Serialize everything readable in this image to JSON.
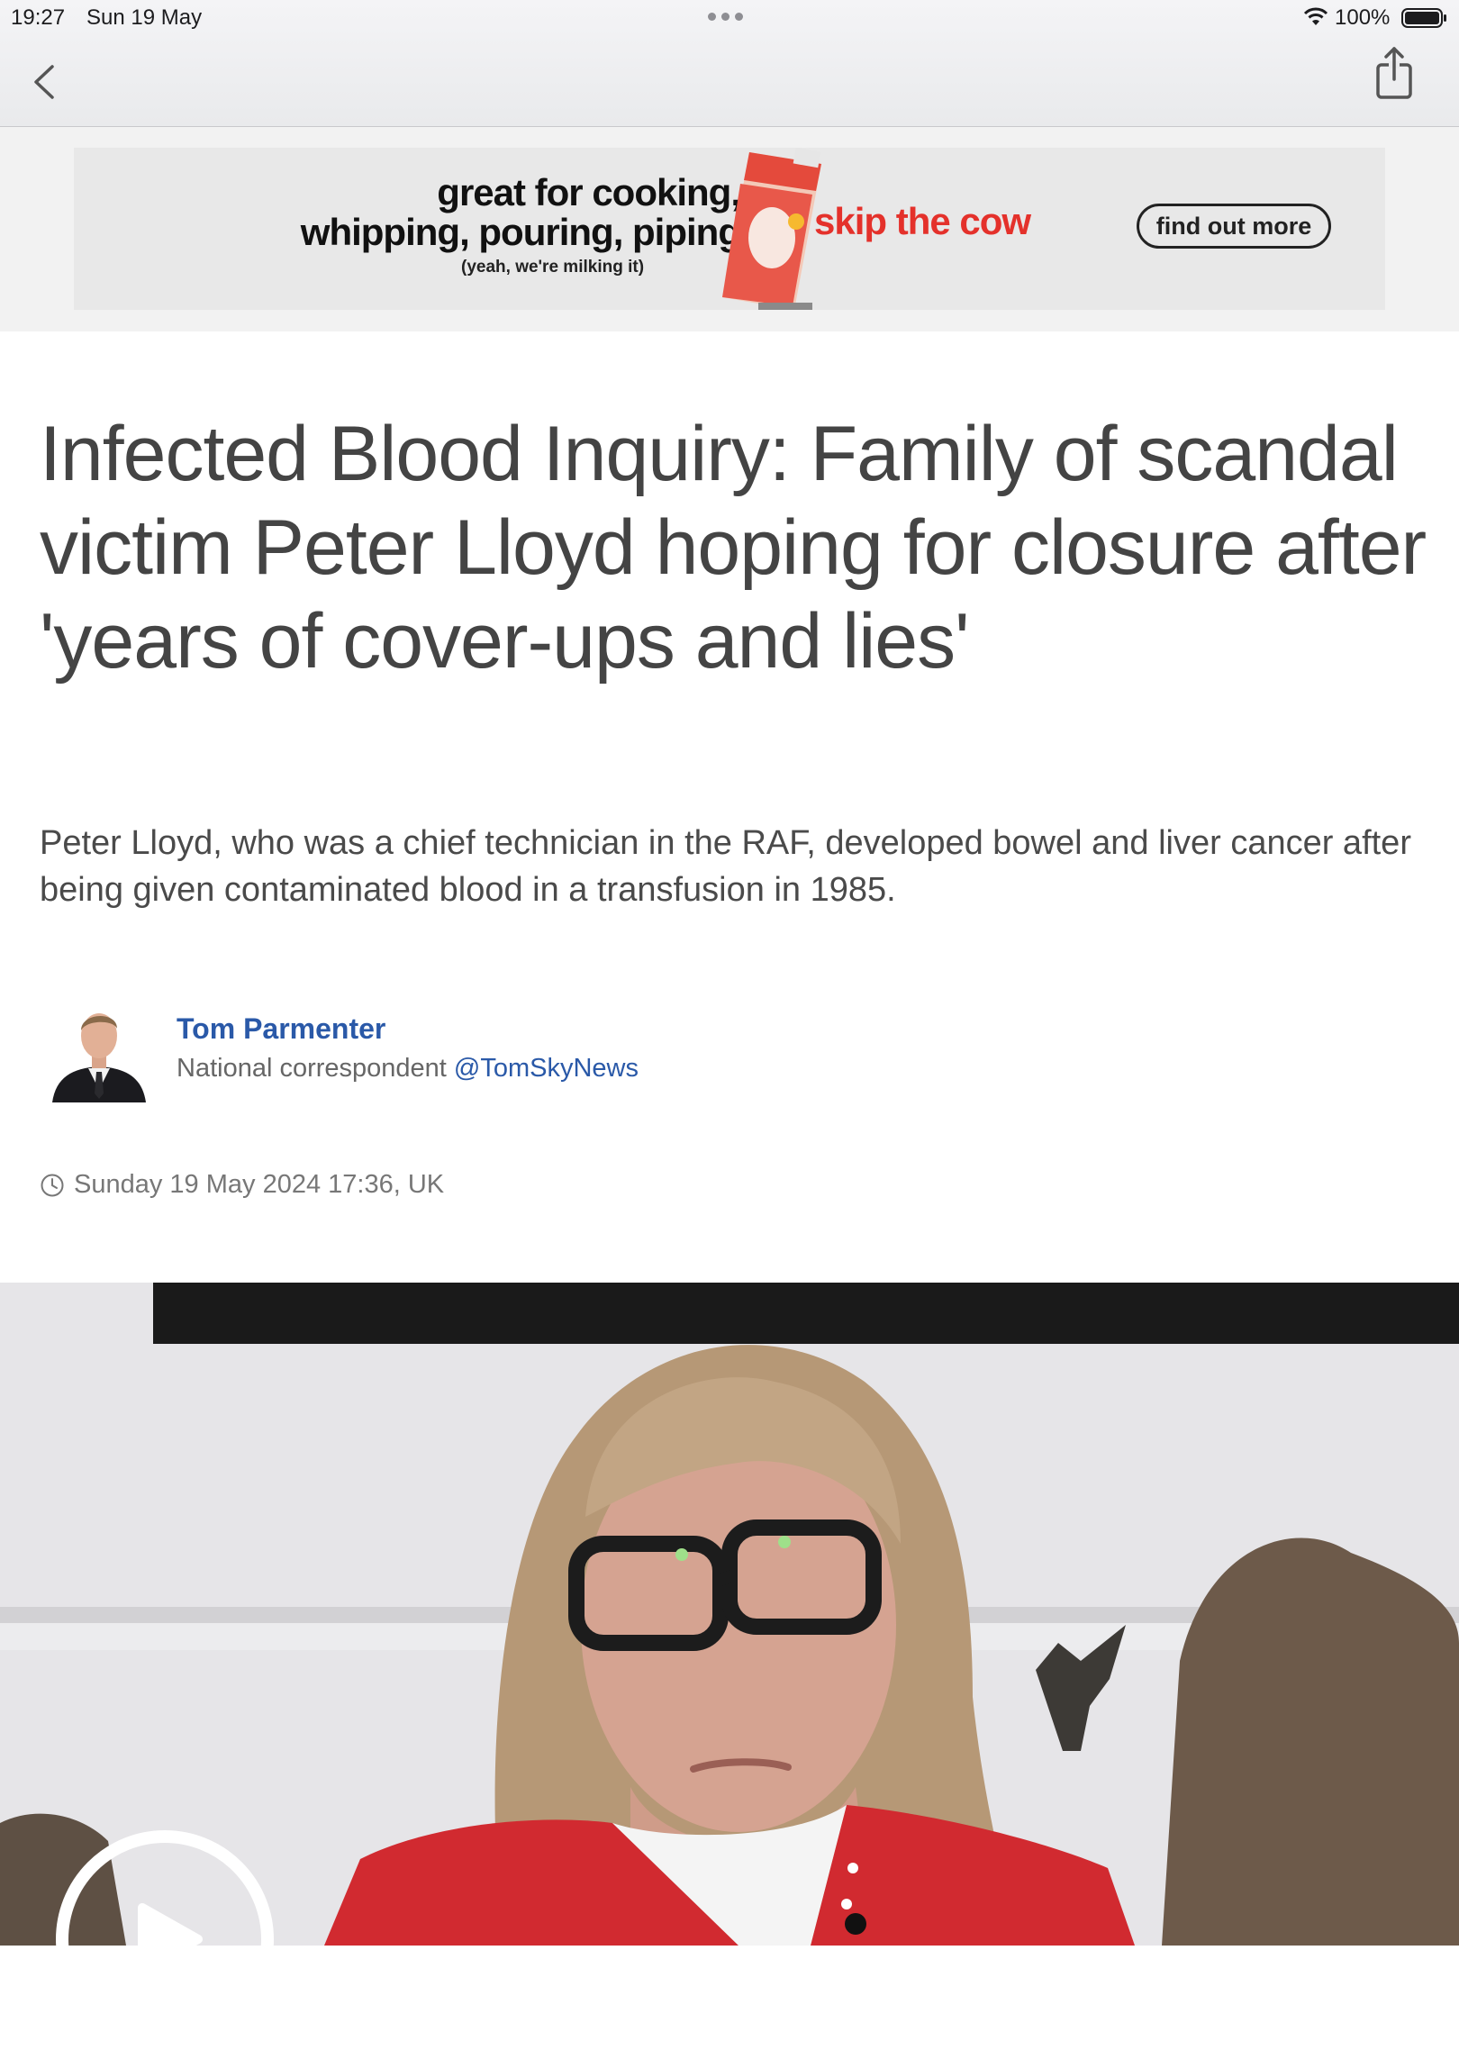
{
  "status_bar": {
    "time": "19:27",
    "date": "Sun 19 May",
    "battery": "100%"
  },
  "nav": {
    "back_icon": "chevron-left-icon",
    "share_icon": "share-icon"
  },
  "ad": {
    "headline_line1": "great for cooking,",
    "headline_line2": "whipping, pouring, piping",
    "small_print": "(yeah, we're milking it)",
    "slogan": "skip the cow",
    "cta": "find out more",
    "accent_color": "#e4312b"
  },
  "article": {
    "headline": "Infected Blood Inquiry: Family of scandal victim Peter Lloyd hoping for closure after 'years of cover-ups and lies'",
    "standfirst": "Peter Lloyd, who was a chief technician in the RAF, developed bowel and liver cancer after being given contaminated blood in a transfusion in 1985.",
    "author": {
      "name": "Tom Parmenter",
      "role": "National correspondent",
      "handle": "@TomSkyNews"
    },
    "timestamp": "Sunday 19 May 2024 17:36, UK",
    "link_color": "#2a59a8"
  },
  "video": {
    "play_icon": "play-icon"
  }
}
